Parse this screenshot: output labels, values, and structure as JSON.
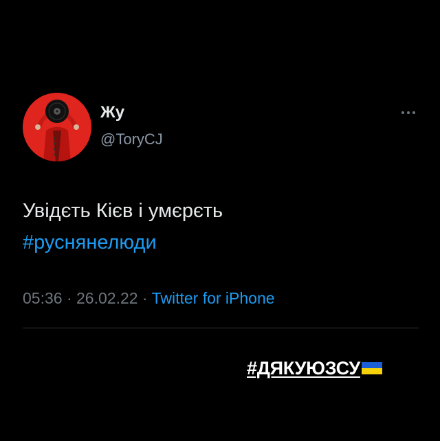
{
  "tweet": {
    "author_name": "Жу",
    "author_handle": "@ToryCJ",
    "text_line": "Увідєть Кієв і умєрєть",
    "hashtag": "#руснянелюди",
    "time": "05:36",
    "separator_1": " · ",
    "date": "26.02.22",
    "separator_2": " · ",
    "source": "Twitter for iPhone"
  },
  "story_overlay": {
    "hashtag": "#ДЯКУЮЗСУ",
    "flag_icon": "ukraine-flag-icon"
  },
  "icons": {
    "more_icon": "more-horizontal-icon",
    "avatar": "profile-avatar"
  },
  "colors": {
    "background": "#000000",
    "text": "#e7e9ea",
    "link": "#1d9bf0",
    "muted": "#6e767d",
    "avatar_bg": "#e0251f",
    "flag_blue": "#1a5fd6",
    "flag_yellow": "#f5d20a"
  }
}
